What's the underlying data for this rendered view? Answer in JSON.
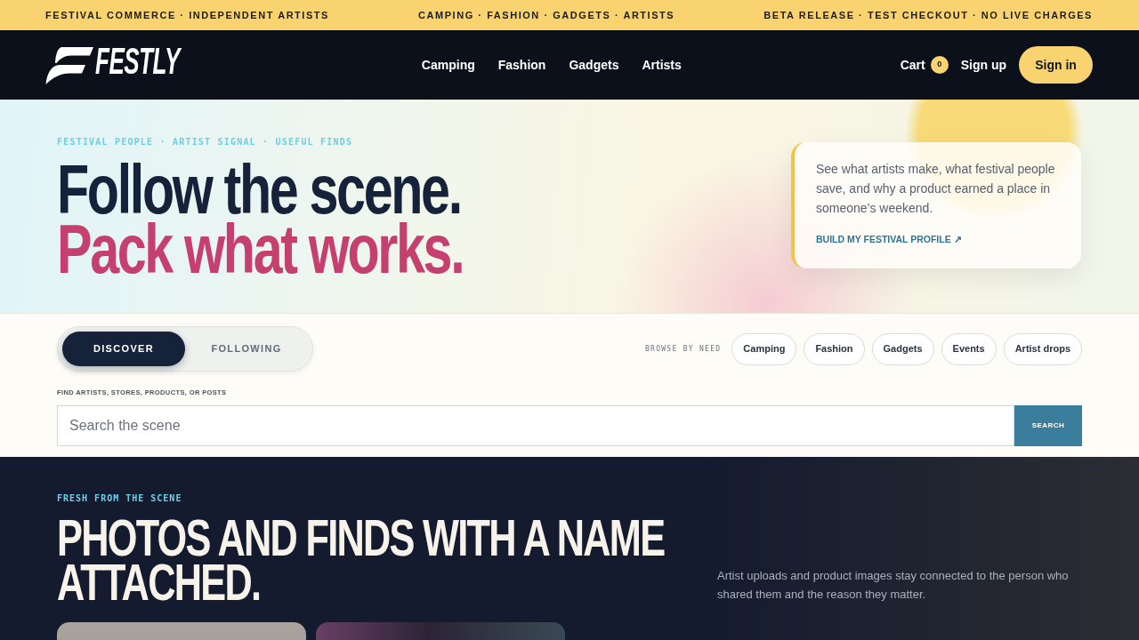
{
  "announcement_bar": {
    "messages": [
      "FESTIVAL COMMERCE · INDEPENDENT ARTISTS",
      "CAMPING · FASHION · GADGETS · ARTISTS",
      "BETA RELEASE · TEST CHECKOUT · NO LIVE CHARGES"
    ]
  },
  "header": {
    "logo": "FESTLY",
    "nav": [
      "Camping",
      "Fashion",
      "Gadgets",
      "Artists"
    ],
    "cart": {
      "label": "Cart",
      "count": "0"
    },
    "sign_up": "Sign up",
    "sign_in": "Sign in"
  },
  "hero": {
    "eyebrow": "FESTIVAL PEOPLE · ARTIST SIGNAL · USEFUL FINDS",
    "headline": [
      {
        "text": "Follow the scene.",
        "color": "#16213a"
      },
      {
        "text": "Pack what works.",
        "color": "#c6406f"
      }
    ],
    "card": {
      "text": "See what artists make, what festival people save, and why a product earned a place in someone’s weekend.",
      "link": "BUILD MY FESTIVAL PROFILE ↗"
    }
  },
  "feed_switch": {
    "tabs": [
      {
        "label": "DISCOVER",
        "selected": true
      },
      {
        "label": "FOLLOWING",
        "selected": false
      }
    ]
  },
  "browse": {
    "label": "BROWSE BY NEED",
    "chips": [
      "Camping",
      "Fashion",
      "Gadgets",
      "Events",
      "Artist drops"
    ]
  },
  "search": {
    "label": "FIND ARTISTS, STORES, PRODUCTS, OR POSTS",
    "placeholder": "Search the scene",
    "button": "SEARCH"
  },
  "fresh": {
    "eyebrow": "FRESH FROM THE SCENE",
    "heading": "PHOTOS AND FINDS WITH A NAME ATTACHED.",
    "description": "Artist uploads and product images stay connected to the person who shared them and the reason they matter.",
    "photos": [
      {
        "kind": "photo"
      },
      {
        "kind": "photo"
      }
    ]
  }
}
